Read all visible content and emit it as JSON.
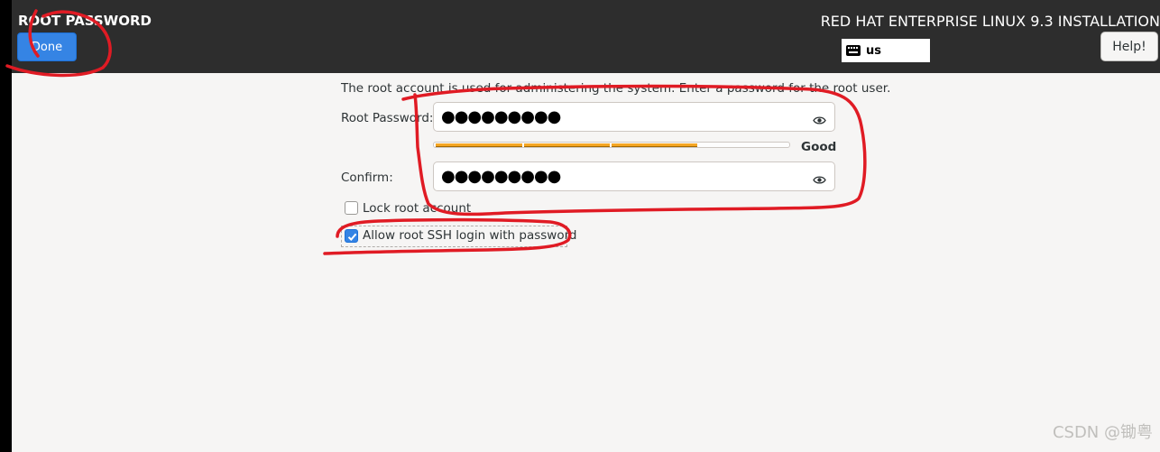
{
  "header": {
    "spoke_title": "ROOT PASSWORD",
    "done_label": "Done",
    "product_title": "RED HAT ENTERPRISE LINUX 9.3 INSTALLATION",
    "keyboard_layout": "us",
    "help_label": "Help!"
  },
  "form": {
    "intro": "The root account is used for administering the system.  Enter a password for the root user.",
    "password_label": "Root Password:",
    "password_value": "●●●●●●●●●",
    "strength_label": "Good",
    "strength_fraction": 0.75,
    "confirm_label": "Confirm:",
    "confirm_value": "●●●●●●●●●",
    "lock_label": "Lock root account",
    "lock_checked": false,
    "ssh_label": "Allow root SSH login with password",
    "ssh_checked": true
  },
  "icons": {
    "keyboard": "keyboard-icon",
    "reveal": "eye-icon",
    "checkmark": "checkmark-icon"
  },
  "colors": {
    "accent": "#3584e4",
    "strength": "#f5a623",
    "annotation": "#e01b24",
    "topbar": "#2d2d2d"
  },
  "watermark": "CSDN @锄粤"
}
